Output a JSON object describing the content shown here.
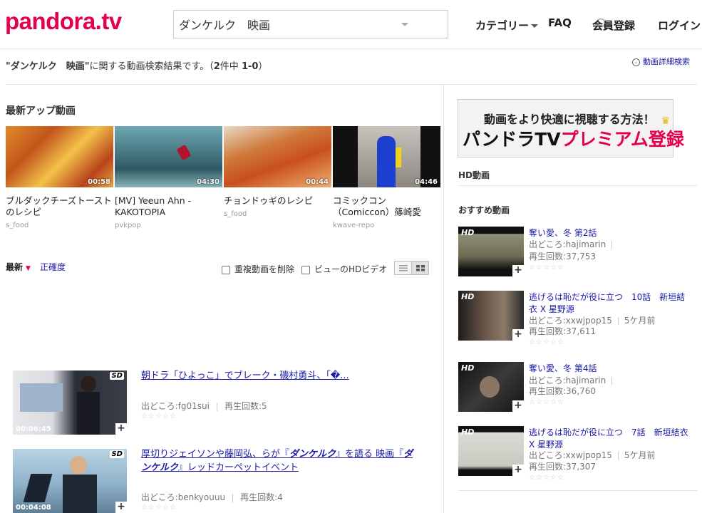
{
  "header": {
    "logo": "pandora.tv",
    "search_value": "ダンケルク　映画",
    "nav": {
      "category": "カテゴリー",
      "faq": "FAQ",
      "register": "会員登録",
      "login": "ログイン"
    }
  },
  "result": {
    "query": "\"ダンケルク　映画\"",
    "suffix": "に関する動画検索結果です。（",
    "count": "2",
    "count_mid": "件中 ",
    "range": "1-0",
    "close": "）",
    "detail_link": "動画詳細検索"
  },
  "latest": {
    "title": "最新アップ動画",
    "videos": [
      {
        "title": "ブルダックチーズトーストのレシピ",
        "source": "s_food",
        "duration": "00:58"
      },
      {
        "title": "[MV] Yeeun Ahn - KAKOTOPIA",
        "source": "pvkpop",
        "duration": "04:30"
      },
      {
        "title": "チョンドゥギのレシピ",
        "source": "s_food",
        "duration": "00:44"
      },
      {
        "title": "コミックコン（Comiccon）篠崎愛",
        "source": "kwave-repo",
        "duration": "04:46"
      }
    ]
  },
  "sort": {
    "newest": "最新",
    "accuracy": "正確度",
    "dedupe": "重複動画を削除",
    "hd": "ビューのHDビデオ"
  },
  "results": [
    {
      "title": "朝ドラ「ひよっこ」でブレーク・磯村勇斗、「�...",
      "source_label": "出どころ:fg01sui",
      "plays": "再生回数:5",
      "duration": "00:06:45",
      "badge": "SD"
    },
    {
      "title_pre": "厚切りジェイソンや藤岡弘、らが『",
      "title_em1": "ダンケルク",
      "title_mid": "』を語る 映画『",
      "title_em2": "ダ",
      "title_line2_em": "ンケルク",
      "title_post": "』レッドカーペットイベント",
      "source_label": "出どころ:benkyouuu",
      "plays": "再生回数:4",
      "duration": "00:04:08",
      "badge": "SD"
    }
  ],
  "sidebar": {
    "banner_line1": "動画をより快適に視聴する方法！",
    "banner_line2a": "パンドラTV",
    "banner_line2b": "プレミアム登録",
    "hd_title": "HD動画",
    "rec_title": "おすすめ動画",
    "items": [
      {
        "title": "奪い愛、冬 第2話",
        "source": "出どころ:hajimarin",
        "ago": "",
        "plays": "再生回数:37,753",
        "badge": "HD"
      },
      {
        "title": "逃げるは恥だが役に立つ　10話　新垣結衣 X 星野源",
        "source": "出どころ:xxwjpop15",
        "ago": "5ケ月前",
        "plays": "再生回数:37,611",
        "badge": "HD"
      },
      {
        "title": "奪い愛、冬 第4話",
        "source": "出どころ:hajimarin",
        "ago": "",
        "plays": "再生回数:36,760",
        "badge": "HD"
      },
      {
        "title": "逃げるは恥だが役に立つ　7話　新垣結衣 X 星野源",
        "source": "出どころ:xxwjpop15",
        "ago": "5ケ月前",
        "plays": "再生回数:37,307",
        "badge": "HD"
      }
    ]
  },
  "colors": {
    "brand": "#e4004f",
    "link": "#1a1aa6",
    "premium": "#e4004f"
  }
}
